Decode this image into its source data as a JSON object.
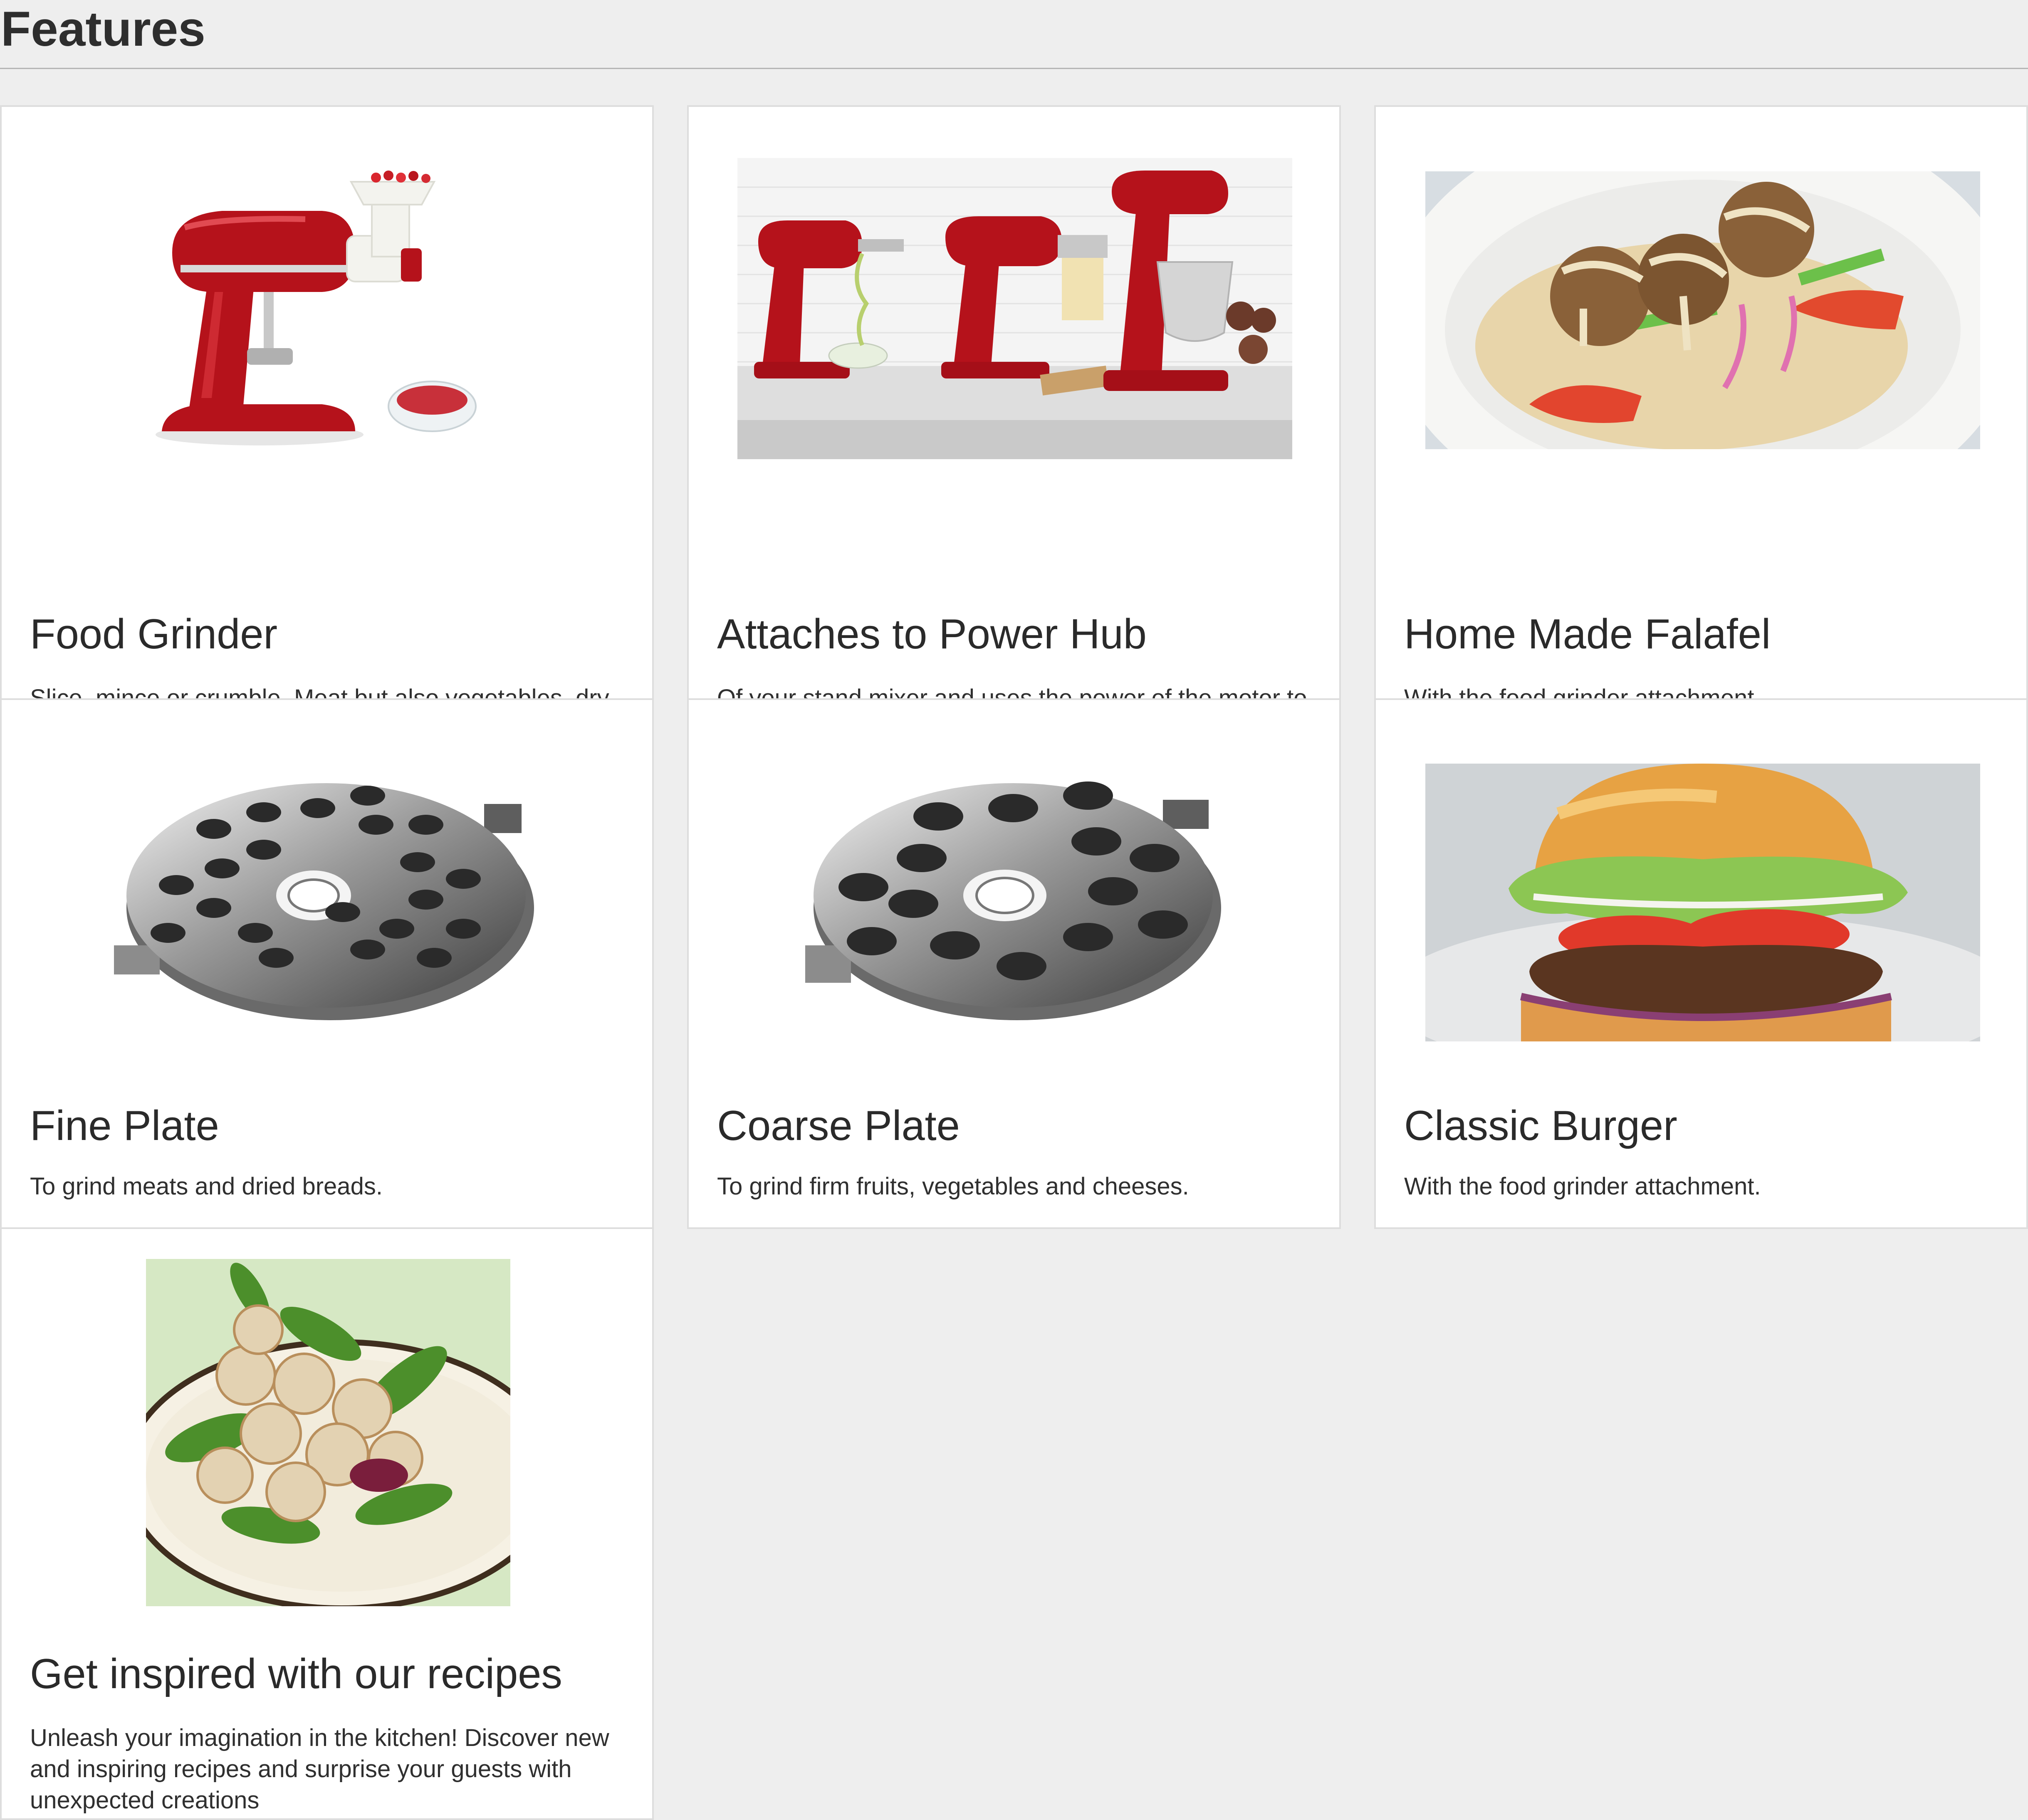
{
  "page": {
    "title": "Features"
  },
  "cards": [
    {
      "title": "Food Grinder",
      "description": "Slice, mince or crumble. Meat but also vegetables, dry bread, fresh fruit and cheese.The food preparation you can make with this attachment are so many!",
      "image": "stand-mixer-with-food-grinder"
    },
    {
      "title": "Attaches to Power Hub",
      "description": "Of your stand mixer and uses the power of the motor to run the attachment. Fits all Household KitchenAid® Stand Mixers.",
      "image": "three-stand-mixers-on-counter"
    },
    {
      "title": "Home Made Falafel",
      "description": "With the food grinder attachment.",
      "image": "falafel-plate"
    },
    {
      "title": "Fine Plate",
      "description": "To grind meats and dried breads.",
      "image": "fine-grinding-plate"
    },
    {
      "title": "Coarse Plate",
      "description": "To grind firm fruits, vegetables and cheeses.",
      "image": "coarse-grinding-plate"
    },
    {
      "title": "Classic Burger",
      "description": "With the food grinder attachment.",
      "image": "classic-burger"
    },
    {
      "title": "Get inspired with our recipes",
      "description": "Unleash your imagination in the kitchen! Discover new and inspiring recipes and surprise your guests with unexpected creations",
      "image": "meatball-salad-plate"
    }
  ],
  "colors": {
    "background": "#eeeeee",
    "card": "#ffffff",
    "mixer_red": "#b5121b",
    "text": "#2b2b2b"
  }
}
